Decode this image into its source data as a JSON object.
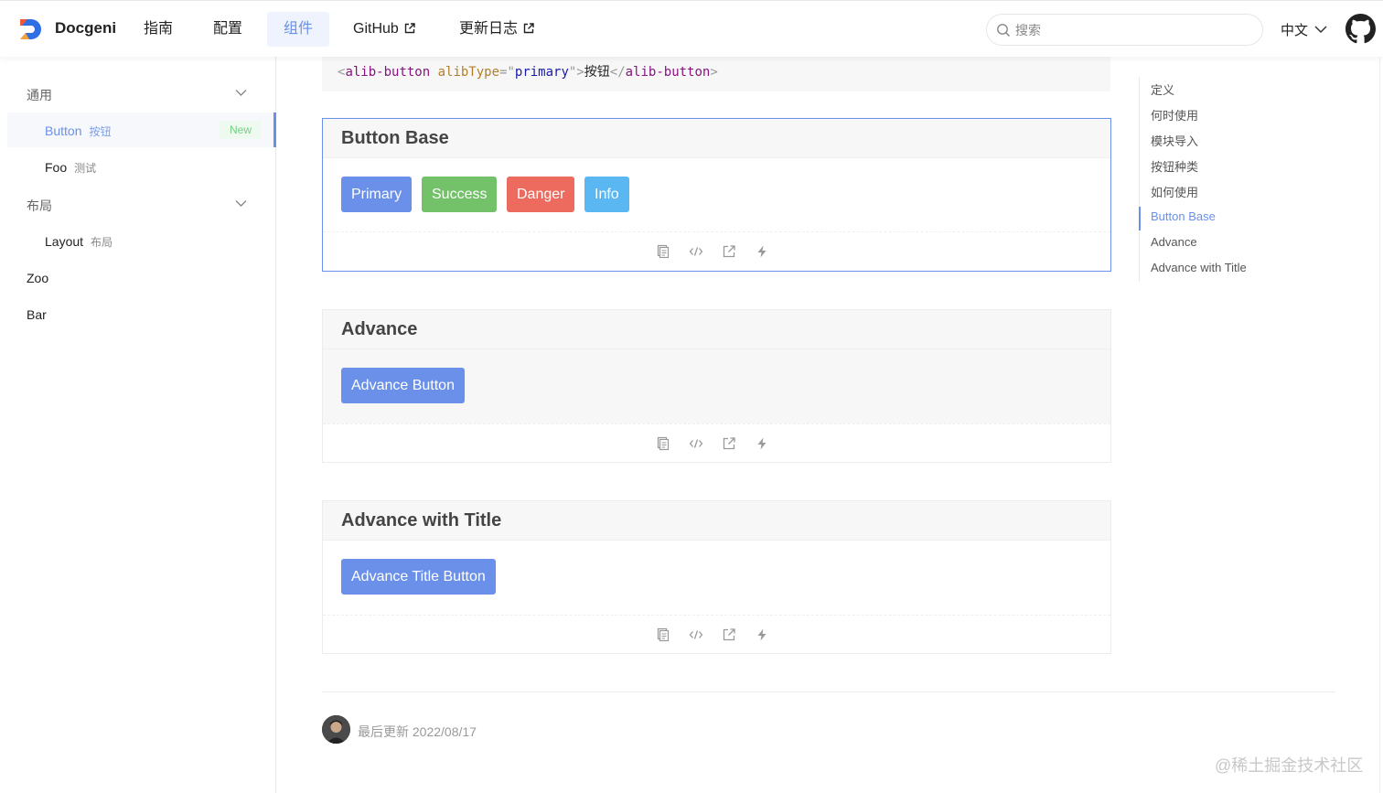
{
  "header": {
    "brand": "Docgeni",
    "nav": [
      {
        "label": "指南",
        "external": false,
        "active": false
      },
      {
        "label": "配置",
        "external": false,
        "active": false
      },
      {
        "label": "组件",
        "external": false,
        "active": true
      },
      {
        "label": "GitHub",
        "external": true,
        "active": false
      },
      {
        "label": "更新日志",
        "external": true,
        "active": false
      }
    ],
    "search_placeholder": "搜索",
    "language": "中文"
  },
  "sidebar": {
    "groups": [
      {
        "label": "通用",
        "expanded": true
      },
      {
        "label": "布局",
        "expanded": true
      }
    ],
    "items": [
      {
        "label": "Button",
        "sub": "按钮",
        "badge": "New",
        "active": true
      },
      {
        "label": "Foo",
        "sub": "测试",
        "active": false
      },
      {
        "label": "Layout",
        "sub": "布局",
        "active": false
      }
    ],
    "roots": [
      "Zoo",
      "Bar"
    ]
  },
  "code_snippet": {
    "open_tag": "alib-button",
    "attr": "alibType",
    "value": "primary",
    "text": "按钮",
    "close_tag": "alib-button"
  },
  "demos": [
    {
      "title": "Button Base",
      "buttons": [
        {
          "label": "Primary",
          "variant": "primary"
        },
        {
          "label": "Success",
          "variant": "success"
        },
        {
          "label": "Danger",
          "variant": "danger"
        },
        {
          "label": "Info",
          "variant": "info"
        }
      ]
    },
    {
      "title": "Advance",
      "buttons": [
        {
          "label": "Advance Button",
          "variant": "primary"
        }
      ]
    },
    {
      "title": "Advance with Title",
      "buttons": [
        {
          "label": "Advance Title Button",
          "variant": "primary"
        }
      ]
    }
  ],
  "demo_actions": [
    "copy-icon",
    "code-icon",
    "open-external-icon",
    "bolt-icon"
  ],
  "toc": [
    {
      "label": "定义",
      "active": false
    },
    {
      "label": "何时使用",
      "active": false
    },
    {
      "label": "模块导入",
      "active": false
    },
    {
      "label": "按钮种类",
      "active": false
    },
    {
      "label": "如何使用",
      "active": false
    },
    {
      "label": "Button Base",
      "active": true
    },
    {
      "label": "Advance",
      "active": false
    },
    {
      "label": "Advance with Title",
      "active": false
    }
  ],
  "footer": {
    "last_updated_label": "最后更新 2022/08/17"
  },
  "watermark": "@稀土掘金技术社区",
  "colors": {
    "accent": "#6a90e9",
    "success": "#73c26a",
    "danger": "#ec6a5e",
    "info": "#5bb7f2",
    "badge_green": "#73d181"
  }
}
